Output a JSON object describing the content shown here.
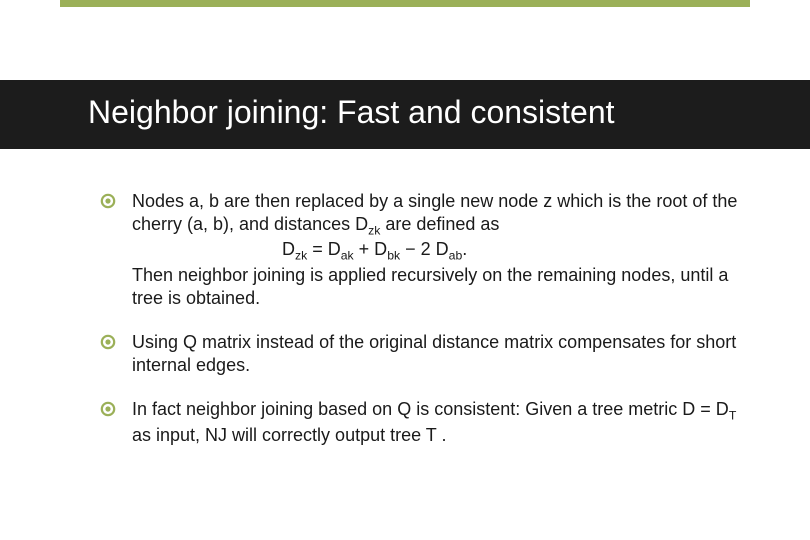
{
  "accent_color": "#9bb058",
  "title": "Neighbor joining: Fast and consistent",
  "bullets": [
    {
      "line1_a": "Nodes a, b are then replaced by a single new node z which is the root of the cherry (a, b), and distances D",
      "line1_sub1": "zk",
      "line1_b": " are defined as",
      "formula_a": "D",
      "formula_sub1": "zk",
      "formula_b": " = D",
      "formula_sub2": "ak",
      "formula_c": " + D",
      "formula_sub3": "bk",
      "formula_d": " − 2 D",
      "formula_sub4": "ab",
      "formula_e": ".",
      "line3": "Then neighbor joining is applied recursively on the remaining nodes, until a tree is obtained."
    },
    {
      "text": "Using Q matrix instead of the original distance matrix compensates for short internal edges."
    },
    {
      "line_a": "In fact neighbor joining based on Q is consistent:  Given a tree metric D = D",
      "line_sub": "T",
      "line_b": " as input, NJ will correctly output tree T ."
    }
  ]
}
